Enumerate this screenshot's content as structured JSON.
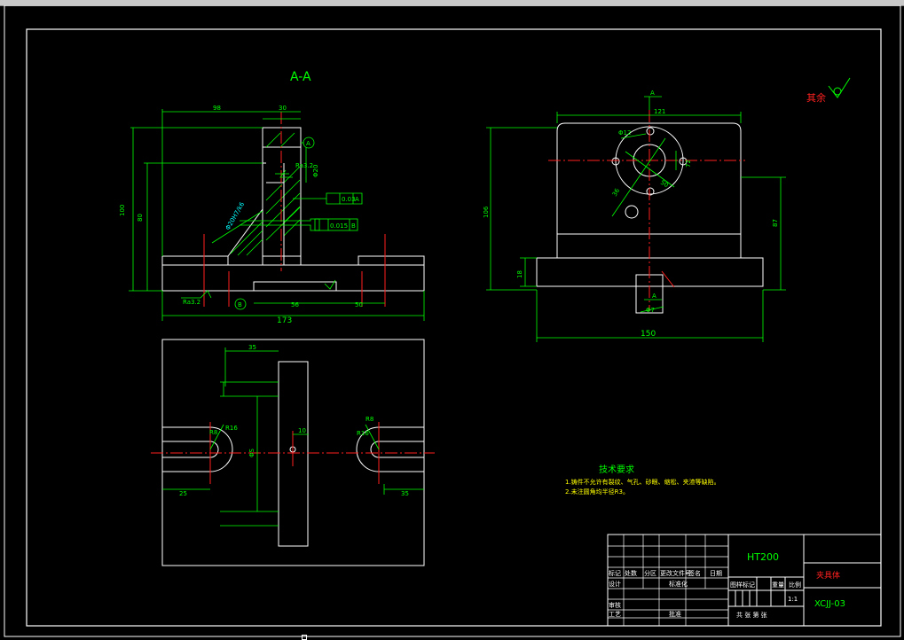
{
  "colors": {
    "white": "#ffffff",
    "green": "#00ff00",
    "red": "#ff2020",
    "cyan": "#00ffff",
    "yellow": "#ffff00",
    "bg": "#000000"
  },
  "section": {
    "title": "A-A"
  },
  "dims": {
    "left_total": "173",
    "left_tall": "100",
    "left_mid": "80",
    "left_top": "98",
    "left_top2": "30",
    "left_bottom_a": "56",
    "left_bottom_b": "50",
    "phi20": "Φ20",
    "ra32": "Ra3.2",
    "ra32b": "Ra3.2",
    "diag_note": "Φ20H7/k6",
    "right_top": "121",
    "right_height": "106",
    "right_height2": "87",
    "right_base": "150",
    "right_base_h": "18",
    "bolt": "Φ12",
    "bolt2": "72",
    "bolt3": "36",
    "bolt4": "50",
    "right_small": "Φ7",
    "plan_top": "35",
    "plan_r1": "R8",
    "plan_r2": "R16",
    "plan_r3": "R8",
    "plan_r4": "R16",
    "plan_l": "25",
    "plan_r": "35",
    "plan_c": "10",
    "plan_mid": "ΦS"
  },
  "tolerances": {
    "tol1": "0.03",
    "tol1_ref": "A",
    "tol2": "0.015",
    "tol2_ref": "B"
  },
  "datums": {
    "a": "A",
    "b": "B"
  },
  "section_marks": {
    "a1": "A",
    "a2": "A"
  },
  "roughness": {
    "label": "其余"
  },
  "notes": {
    "heading": "技术要求",
    "line1": "1.铸件不允许有裂纹、气孔、砂眼、缩松、夹渣等缺陷。",
    "line2": "2.未注圆角均半径R3。"
  },
  "title_block": {
    "material": "HT200",
    "part_name": "夹具体",
    "drawing_no": "XCJJ-03",
    "scale": "1:1",
    "row1": [
      "标记",
      "处数",
      "分区",
      "更改文件号",
      "签名",
      "日期"
    ],
    "designer": "设计",
    "std": "标准化",
    "stage": "图样标记",
    "weight": "重量",
    "scale_label": "比例",
    "check": "审核",
    "process": "工艺",
    "approve": "批准",
    "sheets": "共 张 第 张"
  }
}
